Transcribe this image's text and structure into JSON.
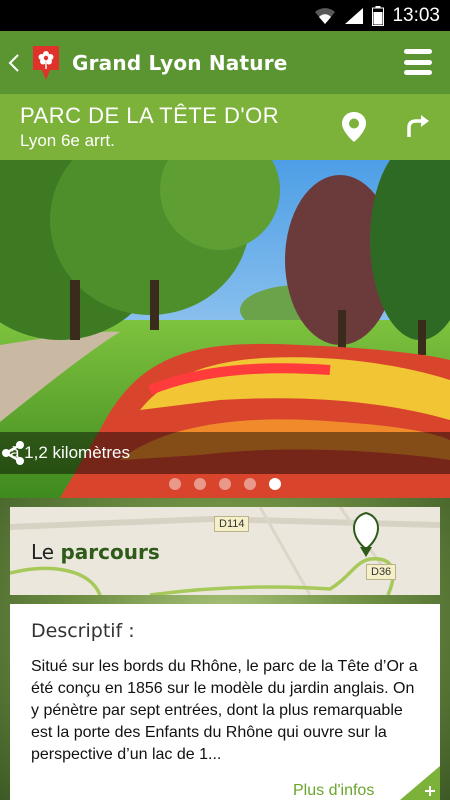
{
  "status_bar": {
    "time": "13:03",
    "icons": [
      "wifi-icon",
      "signal-icon",
      "battery-icon"
    ]
  },
  "app_bar": {
    "title": "Grand Lyon Nature",
    "icons": [
      "back-icon",
      "logo-pin-flower-icon",
      "menu-icon"
    ]
  },
  "park": {
    "name": "PARC DE LA TÊTE D'OR",
    "district": "Lyon 6e arrt.",
    "icons": [
      "location-pin-icon",
      "directions-arrow-icon"
    ]
  },
  "hero": {
    "distance": "à 1,2 kilomètres",
    "carousel": {
      "count": 5,
      "active_index": 4
    },
    "icons": [
      "share-icon"
    ]
  },
  "route_card": {
    "prefix": "Le ",
    "highlight": "parcours",
    "roads": [
      "D114",
      "D36"
    ]
  },
  "description": {
    "heading": "Descriptif :",
    "text": "Situé sur les bords du Rhône, le parc de la Tête d’Or a été conçu en 1856 sur le modèle du jardin anglais. On y pénètre par sept entrées, dont la plus remarquable est la porte des Enfants du Rhône qui ouvre sur la perspective d’un lac de 1...",
    "more_link": "Plus d'infos"
  },
  "colors": {
    "app_bar": "#5b9531",
    "park_bar": "#7cb23a",
    "accent": "#6aa52c",
    "logo_red": "#e0322b"
  }
}
